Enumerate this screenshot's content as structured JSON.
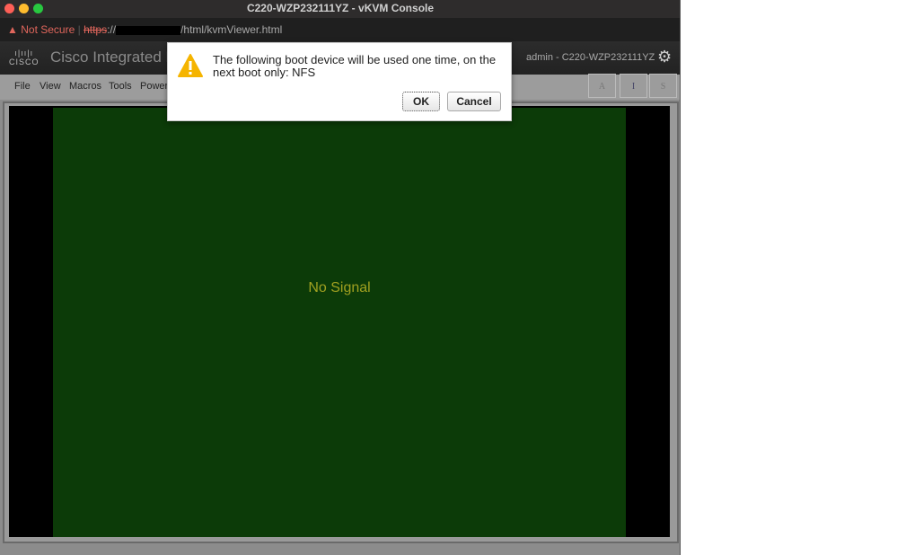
{
  "window": {
    "title": "C220-WZP232111YZ - vKVM Console"
  },
  "address_bar": {
    "security": "Not Secure",
    "scheme": "https",
    "sep": "://",
    "path": "/html/kvmViewer.html"
  },
  "header": {
    "logo": "cisco",
    "product": "Cisco Integrated M",
    "user": "admin - C220-WZP232111YZ"
  },
  "menu": [
    "File",
    "View",
    "Macros",
    "Tools",
    "Power"
  ],
  "keys": [
    "A",
    "I",
    "S"
  ],
  "screen": {
    "status": "No Signal"
  },
  "dialog": {
    "message": "The following boot device will be used one time, on the next boot only: NFS",
    "ok": "OK",
    "cancel": "Cancel"
  },
  "colors": {
    "screen_bg": "#0c3b08",
    "warning": "#f5b400"
  }
}
